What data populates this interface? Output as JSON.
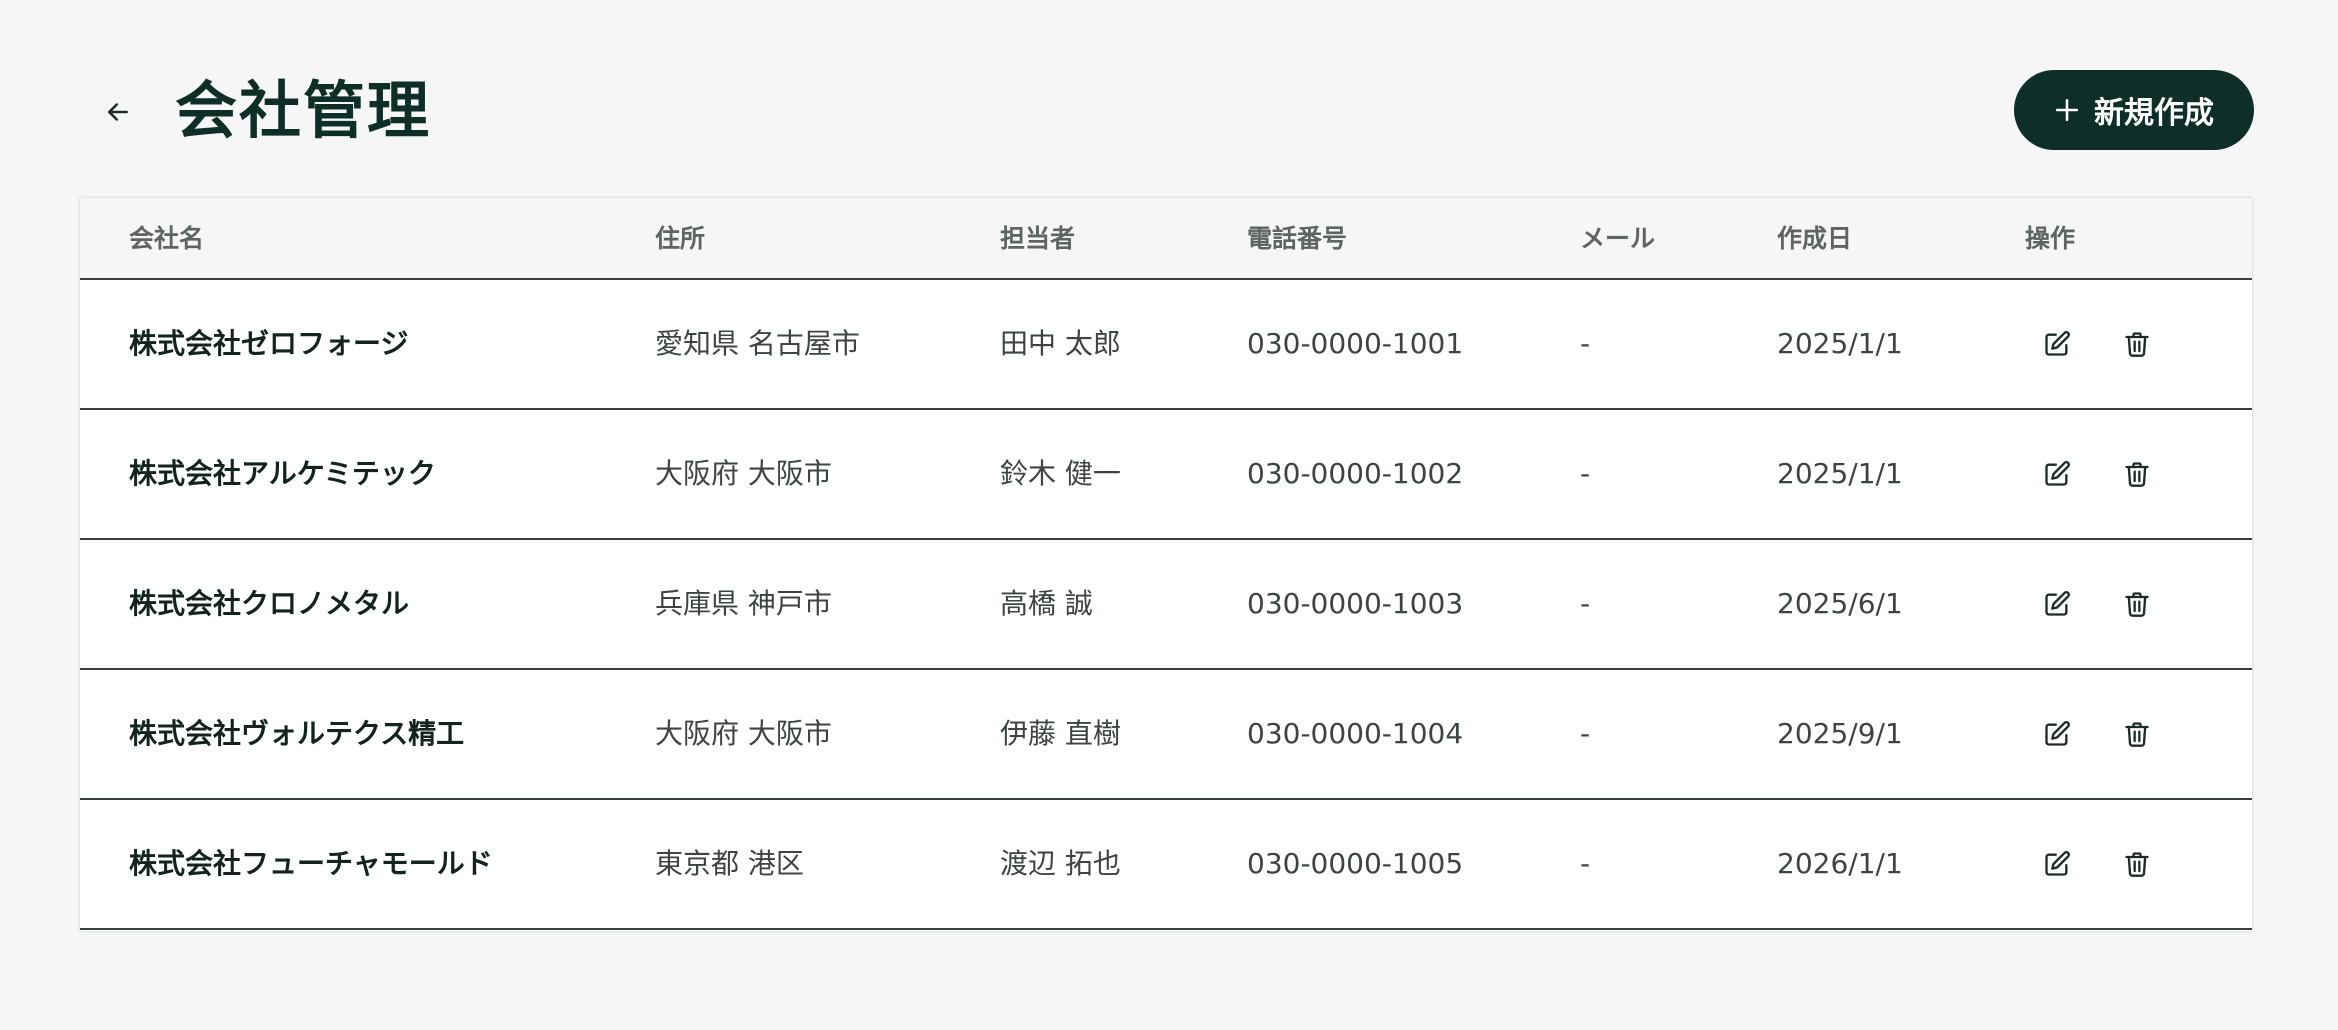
{
  "header": {
    "back_icon": "arrow-left-icon",
    "title": "会社管理",
    "create_button": {
      "icon": "plus-icon",
      "label": "新規作成"
    }
  },
  "table": {
    "columns": [
      "会社名",
      "住所",
      "担当者",
      "電話番号",
      "メール",
      "作成日",
      "操作"
    ],
    "rows": [
      {
        "name": "株式会社ゼロフォージ",
        "address": "愛知県 名古屋市",
        "contact": "田中 太郎",
        "phone": "030-0000-1001",
        "email": "-",
        "created": "2025/1/1"
      },
      {
        "name": "株式会社アルケミテック",
        "address": "大阪府 大阪市",
        "contact": "鈴木 健一",
        "phone": "030-0000-1002",
        "email": "-",
        "created": "2025/1/1"
      },
      {
        "name": "株式会社クロノメタル",
        "address": "兵庫県 神戸市",
        "contact": "高橋 誠",
        "phone": "030-0000-1003",
        "email": "-",
        "created": "2025/6/1"
      },
      {
        "name": "株式会社ヴォルテクス精工",
        "address": "大阪府 大阪市",
        "contact": "伊藤 直樹",
        "phone": "030-0000-1004",
        "email": "-",
        "created": "2025/9/1"
      },
      {
        "name": "株式会社フューチャモールド",
        "address": "東京都 港区",
        "contact": "渡辺 拓也",
        "phone": "030-0000-1005",
        "email": "-",
        "created": "2026/1/1"
      }
    ],
    "row_actions": [
      "edit-icon",
      "trash-icon"
    ]
  },
  "colors": {
    "primary": "#0e2e28",
    "background": "#f6f6f6",
    "surface": "#ffffff",
    "row_divider": "#3a3f3d",
    "header_text": "#5d6461"
  }
}
